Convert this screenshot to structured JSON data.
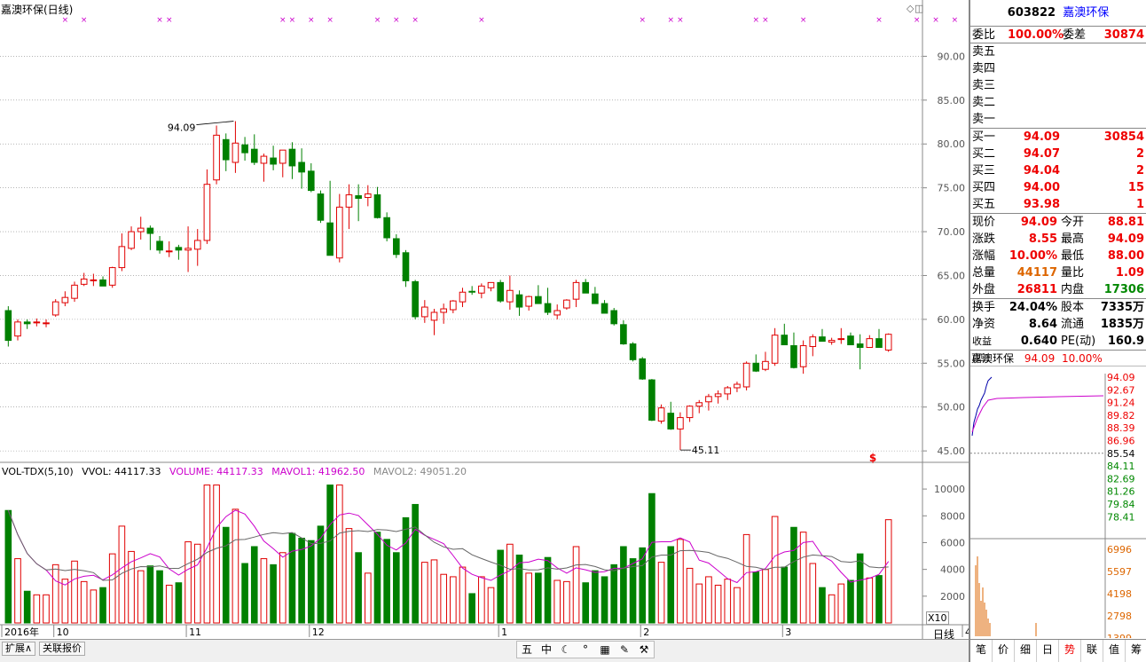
{
  "window": {
    "chart_title": "嘉澳环保(日线)",
    "daily_label": "日线",
    "x_factor": "X10"
  },
  "volume_legend": {
    "indicator": "VOL-TDX(5,10)",
    "vvol": "VVOL: 44117.33",
    "volume": "VOLUME: 44117.33",
    "mavol1": "MAVOL1: 41962.50",
    "mavol2": "MAVOL2: 49051.20"
  },
  "bottom_tabs": [
    "扩展∧",
    "关联报价"
  ],
  "toolbar_glyphs": [
    "五",
    "中",
    "☾",
    "°",
    "▦",
    "✎",
    "⚒"
  ],
  "chart_data": [
    {
      "type": "candlestick",
      "title": "嘉澳环保(日线)",
      "y_ticks": [
        45.0,
        50.0,
        55.0,
        60.0,
        65.0,
        70.0,
        75.0,
        80.0,
        85.0,
        90.0
      ],
      "ylim": [
        44,
        95
      ],
      "x_labels": [
        "2016年",
        "10",
        "11",
        "12",
        "1",
        "2",
        "3",
        "4"
      ],
      "x_label_index": [
        0,
        5,
        19,
        32,
        52,
        67,
        82,
        101
      ],
      "annotations": {
        "max": "94.09",
        "min": "45.11",
        "marker": "$"
      },
      "top_marker_indices": [
        6,
        8,
        16,
        17,
        29,
        30,
        32,
        34,
        39,
        41,
        43,
        50,
        67,
        70,
        71,
        79,
        80,
        84,
        92,
        96,
        98,
        100
      ],
      "colors": {
        "up": "#e00000",
        "down": "#008000",
        "grid": "#888888",
        "axis_text": "#555555"
      },
      "ohlc": [
        [
          61.0,
          61.5,
          56.9,
          57.6
        ],
        [
          58.1,
          60.0,
          57.6,
          59.7
        ],
        [
          59.7,
          60.0,
          58.9,
          59.5
        ],
        [
          59.6,
          60.1,
          59.2,
          59.7
        ],
        [
          59.5,
          60.0,
          59.1,
          59.6
        ],
        [
          60.5,
          62.3,
          60.3,
          62.0
        ],
        [
          61.9,
          63.2,
          61.5,
          62.5
        ],
        [
          62.4,
          64.3,
          62.0,
          63.9
        ],
        [
          64.0,
          65.3,
          63.8,
          64.6
        ],
        [
          64.5,
          65.2,
          63.8,
          64.5
        ],
        [
          64.5,
          64.9,
          64.0,
          63.8
        ],
        [
          63.9,
          66.0,
          63.6,
          65.9
        ],
        [
          65.9,
          69.8,
          65.5,
          68.3
        ],
        [
          68.1,
          70.6,
          67.9,
          70.0
        ],
        [
          70.0,
          71.7,
          69.1,
          70.4
        ],
        [
          70.4,
          70.7,
          67.9,
          69.8
        ],
        [
          68.9,
          69.5,
          67.5,
          67.9
        ],
        [
          67.8,
          68.9,
          67.1,
          67.8
        ],
        [
          68.2,
          68.5,
          66.8,
          67.9
        ],
        [
          67.9,
          70.6,
          65.4,
          68.1
        ],
        [
          68.0,
          70.3,
          66.1,
          69.0
        ],
        [
          69.0,
          77.1,
          68.6,
          75.4
        ],
        [
          75.9,
          82.1,
          75.4,
          81.0
        ],
        [
          80.5,
          81.2,
          76.9,
          78.2
        ],
        [
          77.9,
          82.6,
          76.7,
          80.1
        ],
        [
          79.9,
          80.8,
          78.1,
          79.0
        ],
        [
          79.4,
          81.1,
          77.6,
          77.9
        ],
        [
          77.8,
          78.9,
          75.7,
          78.6
        ],
        [
          78.4,
          79.8,
          77.0,
          77.7
        ],
        [
          77.8,
          79.2,
          76.2,
          79.3
        ],
        [
          79.4,
          80.2,
          76.0,
          77.5
        ],
        [
          77.9,
          79.5,
          74.9,
          76.8
        ],
        [
          76.9,
          77.8,
          74.5,
          74.7
        ],
        [
          74.3,
          74.7,
          71.0,
          71.3
        ],
        [
          71.0,
          75.8,
          67.3,
          67.3
        ],
        [
          67.0,
          74.3,
          66.5,
          72.8
        ],
        [
          72.8,
          75.4,
          70.3,
          74.2
        ],
        [
          74.1,
          75.4,
          71.2,
          73.8
        ],
        [
          73.9,
          75.3,
          72.9,
          74.3
        ],
        [
          74.2,
          75.1,
          71.5,
          71.6
        ],
        [
          71.6,
          72.2,
          68.9,
          69.3
        ],
        [
          69.2,
          69.7,
          67.0,
          67.4
        ],
        [
          67.6,
          67.9,
          63.7,
          64.4
        ],
        [
          64.3,
          64.5,
          60.0,
          60.3
        ],
        [
          60.3,
          62.2,
          59.6,
          61.4
        ],
        [
          59.9,
          61.2,
          58.2,
          60.8
        ],
        [
          60.8,
          61.8,
          59.5,
          61.2
        ],
        [
          61.1,
          62.2,
          60.7,
          62.1
        ],
        [
          62.0,
          63.6,
          61.4,
          63.1
        ],
        [
          63.2,
          63.8,
          62.8,
          63.1
        ],
        [
          63.0,
          64.1,
          62.4,
          63.8
        ],
        [
          63.6,
          64.2,
          63.2,
          64.2
        ],
        [
          64.2,
          64.5,
          61.9,
          62.1
        ],
        [
          62.0,
          65.0,
          61.1,
          63.3
        ],
        [
          62.8,
          63.3,
          60.4,
          61.4
        ],
        [
          61.5,
          62.7,
          61.0,
          62.6
        ],
        [
          62.6,
          63.9,
          61.9,
          61.8
        ],
        [
          61.8,
          63.6,
          60.5,
          60.8
        ],
        [
          60.5,
          61.7,
          60.0,
          61.0
        ],
        [
          61.3,
          62.3,
          61.1,
          62.2
        ],
        [
          62.3,
          64.5,
          61.4,
          64.2
        ],
        [
          64.2,
          64.6,
          63.8,
          63.0
        ],
        [
          62.9,
          63.7,
          61.8,
          61.8
        ],
        [
          61.8,
          62.2,
          60.8,
          60.7
        ],
        [
          61.0,
          61.3,
          59.3,
          59.5
        ],
        [
          59.4,
          59.9,
          57.1,
          57.2
        ],
        [
          57.2,
          57.4,
          55.2,
          55.4
        ],
        [
          55.5,
          55.7,
          53.1,
          53.2
        ],
        [
          53.1,
          53.2,
          48.4,
          48.5
        ],
        [
          48.4,
          50.3,
          48.1,
          49.9
        ],
        [
          49.3,
          50.6,
          47.4,
          47.5
        ],
        [
          47.5,
          49.4,
          45.1,
          48.8
        ],
        [
          48.8,
          50.2,
          48.3,
          50.1
        ],
        [
          50.1,
          50.8,
          49.3,
          50.5
        ],
        [
          50.6,
          51.5,
          49.6,
          51.2
        ],
        [
          51.2,
          51.9,
          50.4,
          51.5
        ],
        [
          51.5,
          52.4,
          50.8,
          52.2
        ],
        [
          52.2,
          52.9,
          51.7,
          52.6
        ],
        [
          52.3,
          55.2,
          51.9,
          55.0
        ],
        [
          55.0,
          56.0,
          54.0,
          54.1
        ],
        [
          54.3,
          56.3,
          54.1,
          55.2
        ],
        [
          55.0,
          59.0,
          54.7,
          58.2
        ],
        [
          58.2,
          59.5,
          57.3,
          57.1
        ],
        [
          57.0,
          58.5,
          54.4,
          54.5
        ],
        [
          54.6,
          57.6,
          53.8,
          57.0
        ],
        [
          56.9,
          58.3,
          55.8,
          58.0
        ],
        [
          58.0,
          58.9,
          57.8,
          57.5
        ],
        [
          57.4,
          57.9,
          57.1,
          57.6
        ],
        [
          57.7,
          59.0,
          57.2,
          57.8
        ],
        [
          58.1,
          58.5,
          57.3,
          57.1
        ],
        [
          57.2,
          58.3,
          54.3,
          56.8
        ],
        [
          56.8,
          58.2,
          56.8,
          57.8
        ],
        [
          57.8,
          58.9,
          57.3,
          56.8
        ],
        [
          56.5,
          58.4,
          56.3,
          58.3
        ]
      ]
    }
  ],
  "right_panel": {
    "code": "603822",
    "name": "嘉澳环保",
    "weibi_label": "委比",
    "weibi_value": "100.00%",
    "weicha_label": "委差",
    "weicha_value": "30874",
    "sell_labels": [
      "卖五",
      "卖四",
      "卖三",
      "卖二",
      "卖一"
    ],
    "buy": [
      {
        "label": "买一",
        "price": "94.09",
        "vol": "30854"
      },
      {
        "label": "买二",
        "price": "94.07",
        "vol": "2"
      },
      {
        "label": "买三",
        "price": "94.04",
        "vol": "2"
      },
      {
        "label": "买四",
        "price": "94.00",
        "vol": "15"
      },
      {
        "label": "买五",
        "price": "93.98",
        "vol": "1"
      }
    ],
    "quote": [
      {
        "k1": "现价",
        "v1": "94.09",
        "k2": "今开",
        "v2": "88.81"
      },
      {
        "k1": "涨跌",
        "v1": "8.55",
        "k2": "最高",
        "v2": "94.09"
      },
      {
        "k1": "涨幅",
        "v1": "10.00%",
        "k2": "最低",
        "v2": "88.00"
      },
      {
        "k1": "总量",
        "v1": "44117",
        "k2": "量比",
        "v2": "1.09"
      },
      {
        "k1": "外盘",
        "v1": "26811",
        "k2": "内盘",
        "v2": "17306"
      }
    ],
    "fund": [
      {
        "k1": "换手",
        "v1": "24.04%",
        "k2": "股本",
        "v2": "7335万"
      },
      {
        "k1": "净资",
        "v1": "8.64",
        "k2": "流通",
        "v2": "1835万"
      },
      {
        "k1": "收益(四)",
        "v1": "0.640",
        "k2": "PE(动)",
        "v2": "160.9"
      }
    ],
    "mini_chart": {
      "name": "嘉澳环保",
      "price": "94.09",
      "pct": "10.00%",
      "price_ticks": [
        "94.09",
        "92.67",
        "91.24",
        "89.82",
        "88.39",
        "86.96",
        "85.54",
        "84.11",
        "82.69",
        "81.26",
        "79.84",
        "78.41"
      ],
      "vol_ticks": [
        "6996",
        "5597",
        "4198",
        "2798",
        "1399"
      ]
    },
    "tabs": [
      "笔",
      "价",
      "细",
      "日",
      "势",
      "联",
      "值",
      "筹"
    ],
    "active_tab": "势"
  }
}
